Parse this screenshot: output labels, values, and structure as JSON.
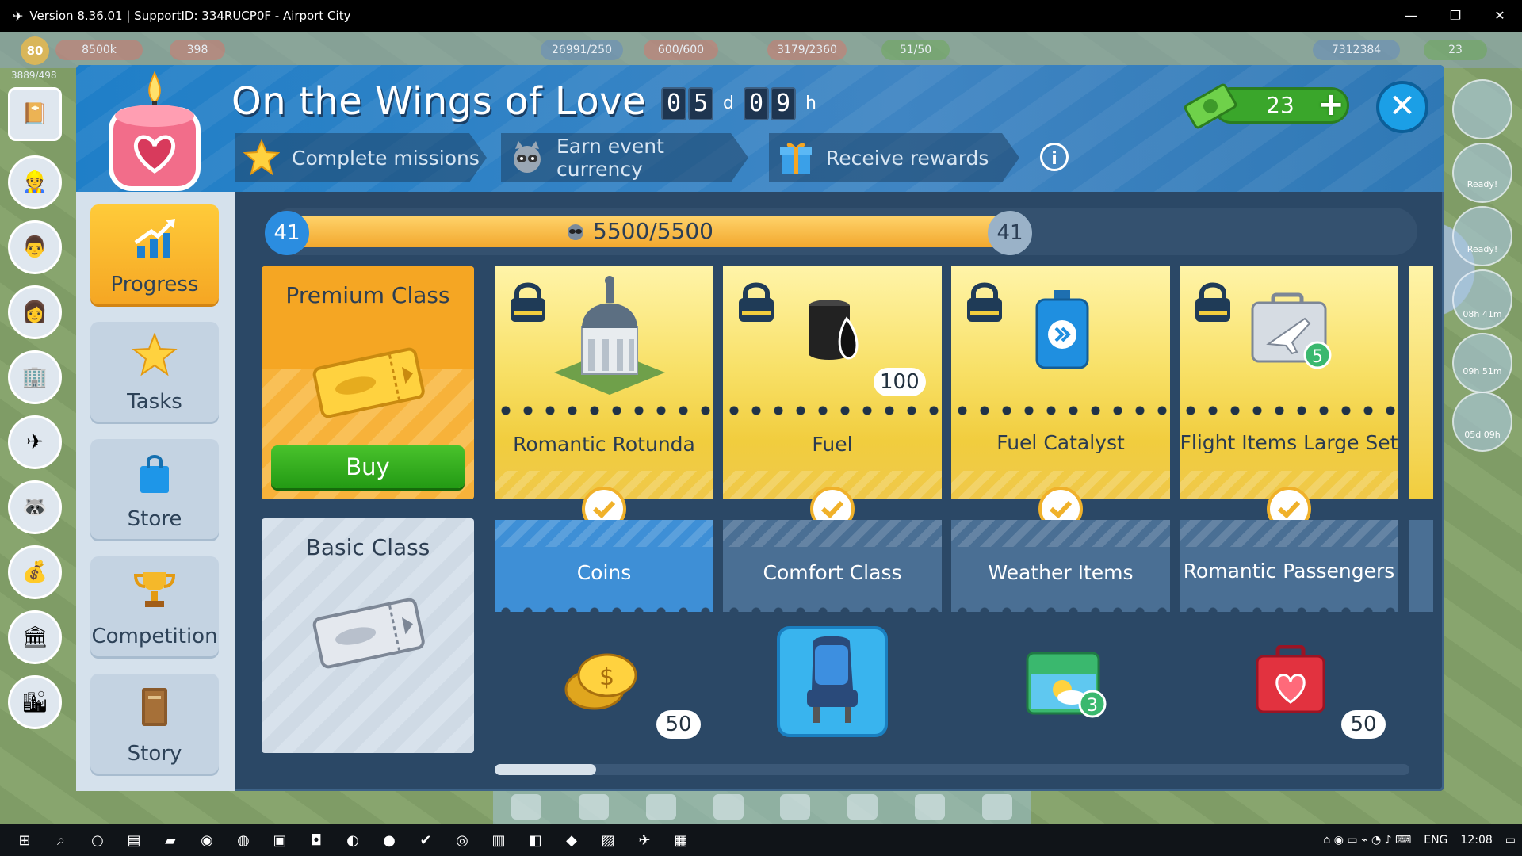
{
  "window": {
    "title": "Version 8.36.01 | SupportID: 334RUCP0F - Airport City"
  },
  "hud": {
    "level": "80",
    "coins": "8500k",
    "stars": "398",
    "passengers": "3889/498",
    "stat1": "26991/250",
    "stat2": "600/600",
    "stat3": "3179/2360",
    "stat4": "51/50",
    "coins_total": "7312384",
    "cash": "23"
  },
  "right_panel": {
    "ready1": "Ready!",
    "ready2": "Ready!",
    "timer1": "08h 41m",
    "timer2": "09h 51m",
    "timer3": "05d 09h"
  },
  "event": {
    "title": "On the Wings of Love",
    "timer_days": [
      "0",
      "5"
    ],
    "timer_hours": [
      "0",
      "9"
    ],
    "day_unit": "d",
    "hour_unit": "h",
    "steps": [
      "Complete missions",
      "Earn event currency",
      "Receive rewards"
    ],
    "currency_value": "23"
  },
  "menu": {
    "items": [
      "Progress",
      "Tasks",
      "Store",
      "Competition",
      "Story"
    ],
    "active": "Progress"
  },
  "progress": {
    "level_left": "41",
    "level_right": "41",
    "text": "5500/5500",
    "fill_fraction": 1.0
  },
  "classes": {
    "premium_title": "Premium Class",
    "buy_label": "Buy",
    "basic_title": "Basic Class"
  },
  "rewards": {
    "premium": [
      {
        "name": "Romantic Rotunda",
        "qty": ""
      },
      {
        "name": "Fuel",
        "qty": "100"
      },
      {
        "name": "Fuel Catalyst",
        "qty": ""
      },
      {
        "name": "Flight Items Large Set",
        "qty": ""
      }
    ],
    "basic": [
      {
        "name": "Coins",
        "qty": "50"
      },
      {
        "name": "Comfort Class",
        "qty": ""
      },
      {
        "name": "Weather Items",
        "qty": ""
      },
      {
        "name": "Romantic Passengers",
        "qty": "50"
      }
    ]
  },
  "taskbar": {
    "lang": "ENG",
    "time": "12:08"
  },
  "colors": {
    "accent_blue": "#1b9fe6",
    "premium_yellow": "#f8e066",
    "buy_green": "#239a14",
    "progress_orange": "#f2a82e"
  }
}
